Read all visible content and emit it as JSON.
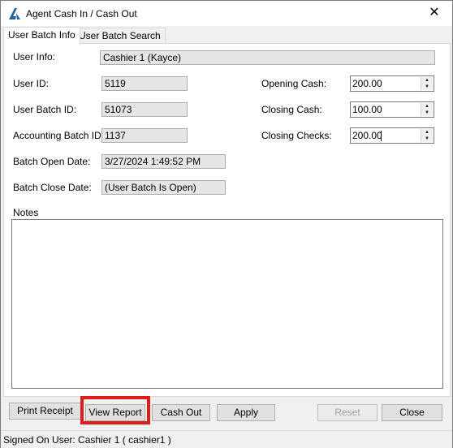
{
  "window": {
    "title": "Agent Cash In / Cash Out"
  },
  "tabs": [
    {
      "label": "User Batch Info",
      "active": true
    },
    {
      "label": "User Batch Search",
      "active": false
    }
  ],
  "form": {
    "user_info_label": "User Info:",
    "user_info_value": "Cashier 1 (Kayce)",
    "user_id_label": "User ID:",
    "user_id_value": "5119",
    "user_batch_id_label": "User Batch ID:",
    "user_batch_id_value": "51073",
    "accounting_batch_id_label": "Accounting Batch ID:",
    "accounting_batch_id_value": "1137",
    "batch_open_date_label": "Batch Open Date:",
    "batch_open_date_value": "3/27/2024 1:49:52 PM",
    "batch_close_date_label": "Batch Close Date:",
    "batch_close_date_value": "(User Batch Is Open)",
    "opening_cash_label": "Opening Cash:",
    "opening_cash_value": "200.00",
    "closing_cash_label": "Closing Cash:",
    "closing_cash_value": "100.00",
    "closing_checks_label": "Closing Checks:",
    "closing_checks_value": "200.00",
    "notes_label": "Notes",
    "notes_value": ""
  },
  "buttons": {
    "print_receipt": "Print Receipt",
    "view_report": "View Report",
    "cash_out": "Cash Out",
    "apply": "Apply",
    "reset": "Reset",
    "close": "Close"
  },
  "status": {
    "text": "Signed On User: Cashier 1 ( cashier1 )"
  },
  "colors": {
    "highlight": "#e31a1a",
    "app_icon": "#1f5fa8"
  }
}
